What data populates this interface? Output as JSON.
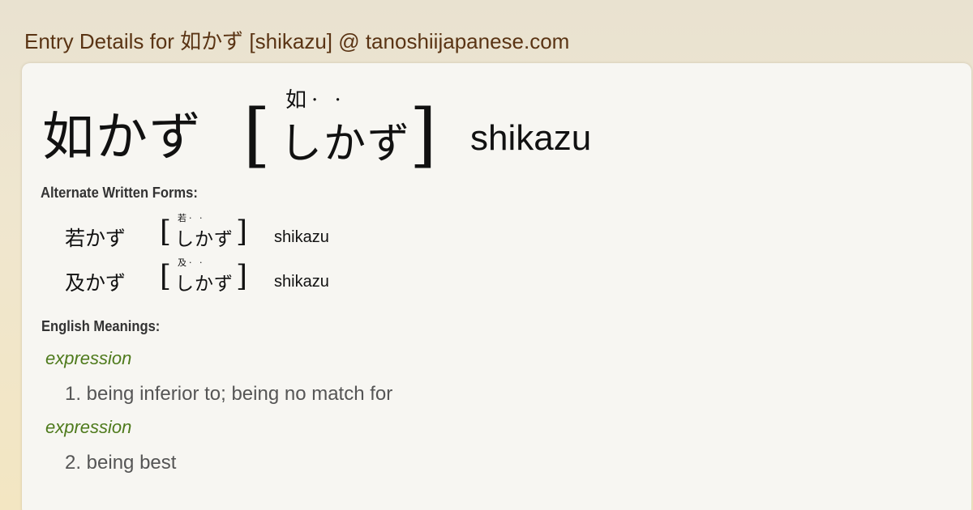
{
  "page_title": "Entry Details for 如かず [shikazu] @ tanoshiijapanese.com",
  "entry": {
    "kanji": "如かず",
    "furigana": "如·  ·",
    "reading": "しかず",
    "romaji": "shikazu"
  },
  "alternate_forms_label": "Alternate Written Forms:",
  "alternate_forms": [
    {
      "kanji": "若かず",
      "furigana": "若·  ·",
      "reading": "しかず",
      "romaji": "shikazu"
    },
    {
      "kanji": "及かず",
      "furigana": "及·  ·",
      "reading": "しかず",
      "romaji": "shikazu"
    }
  ],
  "meanings_label": "English Meanings:",
  "meanings": [
    {
      "pos": "expression",
      "gloss": "1. being inferior to; being no match for"
    },
    {
      "pos": "expression",
      "gloss": "2. being best"
    }
  ],
  "colors": {
    "title": "#5a3414",
    "pos": "#4e7a1c",
    "gloss": "#555555",
    "card": "#f7f6f2"
  }
}
